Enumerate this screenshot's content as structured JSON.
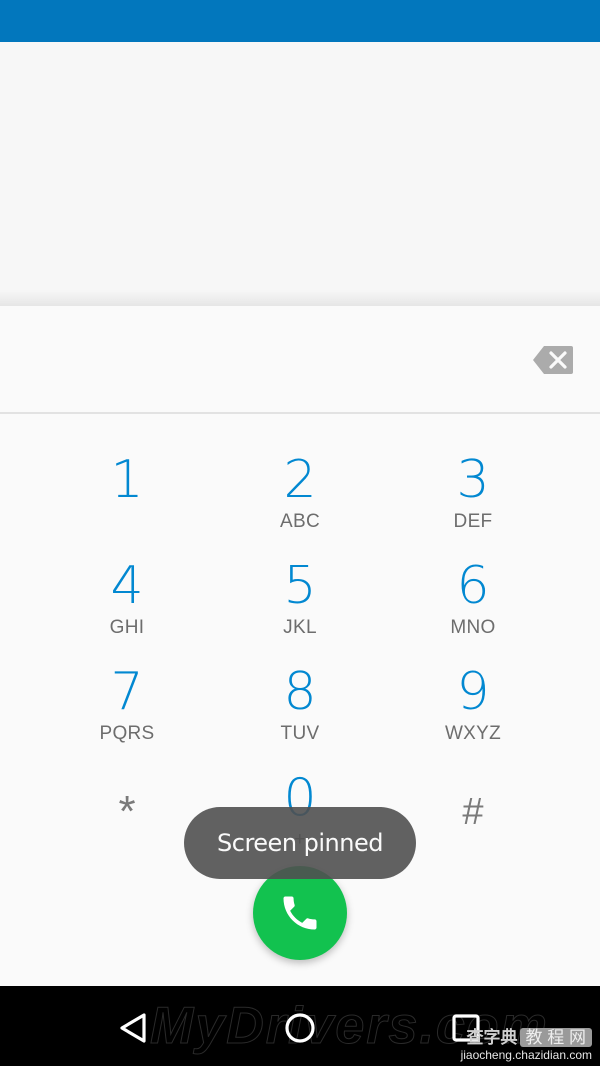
{
  "status_bar": {
    "color": "#0277bd"
  },
  "dialpad": {
    "digits_value": "",
    "accent_color": "#0288d1",
    "keys": [
      {
        "num": "1",
        "letters": "",
        "icon": "voicemail-icon"
      },
      {
        "num": "2",
        "letters": "ABC"
      },
      {
        "num": "3",
        "letters": "DEF"
      },
      {
        "num": "4",
        "letters": "GHI"
      },
      {
        "num": "5",
        "letters": "JKL"
      },
      {
        "num": "6",
        "letters": "MNO"
      },
      {
        "num": "7",
        "letters": "PQRS"
      },
      {
        "num": "8",
        "letters": "TUV"
      },
      {
        "num": "9",
        "letters": "WXYZ"
      },
      {
        "num": "*",
        "letters": ""
      },
      {
        "num": "0",
        "letters": "+"
      },
      {
        "num": "#",
        "letters": ""
      }
    ],
    "backspace_icon": "backspace-icon",
    "call_button": {
      "icon": "phone-icon",
      "color": "#12c24f"
    }
  },
  "toast": {
    "text": "Screen pinned"
  },
  "nav_bar": {
    "back_icon": "back-triangle-icon",
    "home_icon": "home-circle-icon",
    "recents_icon": "recents-square-icon"
  },
  "watermarks": {
    "main": "MyDrivers.com",
    "cn_title": "查字典",
    "cn_box": "教 程 网",
    "url": "jiaocheng.chazidian.com"
  }
}
